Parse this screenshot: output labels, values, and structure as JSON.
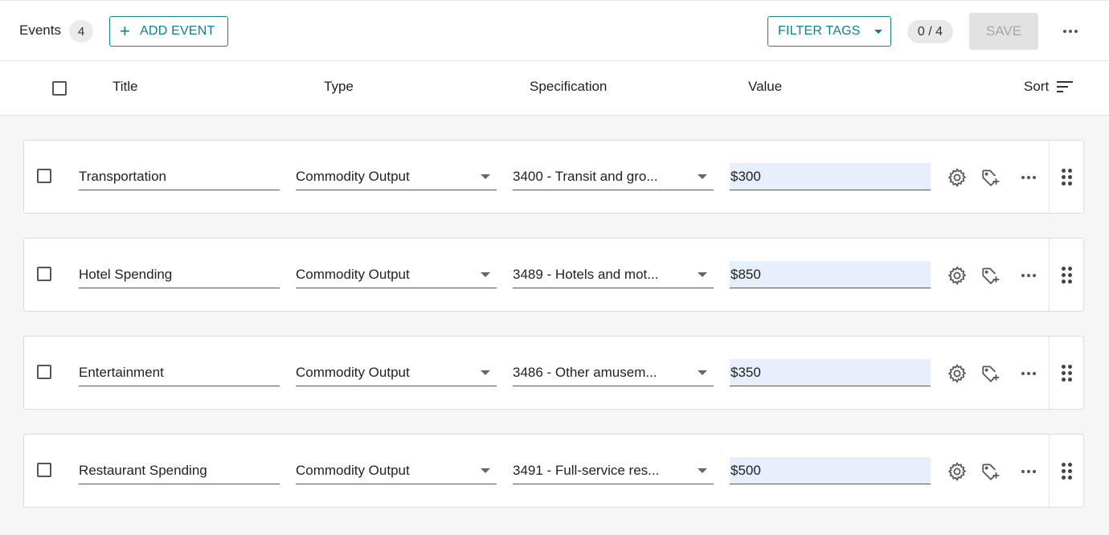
{
  "toolbar": {
    "events_label": "Events",
    "events_count": "4",
    "add_event_label": "ADD EVENT",
    "filter_tags_label": "FILTER TAGS",
    "selection_ratio": "0 / 4",
    "save_label": "SAVE"
  },
  "columns": {
    "title": "Title",
    "type": "Type",
    "specification": "Specification",
    "value": "Value",
    "sort": "Sort"
  },
  "events": [
    {
      "title": "Transportation",
      "type": "Commodity Output",
      "specification": "3400 - Transit and gro...",
      "value": "$300"
    },
    {
      "title": "Hotel Spending",
      "type": "Commodity Output",
      "specification": "3489 - Hotels and mot...",
      "value": "$850"
    },
    {
      "title": "Entertainment",
      "type": "Commodity Output",
      "specification": "3486 - Other amusem...",
      "value": "$350"
    },
    {
      "title": "Restaurant Spending",
      "type": "Commodity Output",
      "specification": "3491 - Full-service res...",
      "value": "$500"
    }
  ],
  "colors": {
    "accent": "#0e7f89",
    "value_field_bg": "#e7effd",
    "save_disabled_bg": "#e2e2e2"
  }
}
